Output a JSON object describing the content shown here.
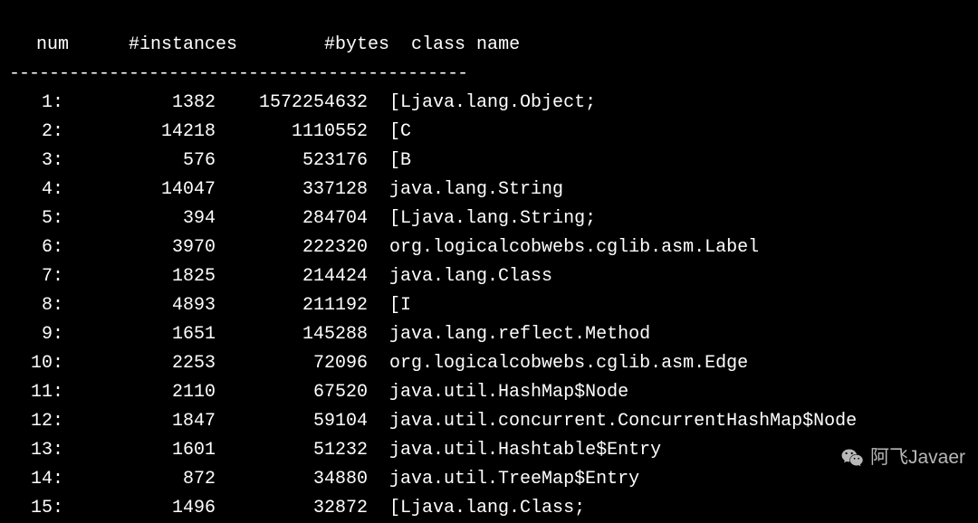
{
  "headers": {
    "num": "num",
    "instances": "#instances",
    "bytes": "#bytes",
    "className": "class name"
  },
  "separator": "----------------------------------------------",
  "rows": [
    {
      "num": "1:",
      "instances": "1382",
      "bytes": "1572254632",
      "className": "[Ljava.lang.Object;"
    },
    {
      "num": "2:",
      "instances": "14218",
      "bytes": "1110552",
      "className": "[C"
    },
    {
      "num": "3:",
      "instances": "576",
      "bytes": "523176",
      "className": "[B"
    },
    {
      "num": "4:",
      "instances": "14047",
      "bytes": "337128",
      "className": "java.lang.String"
    },
    {
      "num": "5:",
      "instances": "394",
      "bytes": "284704",
      "className": "[Ljava.lang.String;"
    },
    {
      "num": "6:",
      "instances": "3970",
      "bytes": "222320",
      "className": "org.logicalcobwebs.cglib.asm.Label"
    },
    {
      "num": "7:",
      "instances": "1825",
      "bytes": "214424",
      "className": "java.lang.Class"
    },
    {
      "num": "8:",
      "instances": "4893",
      "bytes": "211192",
      "className": "[I"
    },
    {
      "num": "9:",
      "instances": "1651",
      "bytes": "145288",
      "className": "java.lang.reflect.Method"
    },
    {
      "num": "10:",
      "instances": "2253",
      "bytes": "72096",
      "className": "org.logicalcobwebs.cglib.asm.Edge"
    },
    {
      "num": "11:",
      "instances": "2110",
      "bytes": "67520",
      "className": "java.util.HashMap$Node"
    },
    {
      "num": "12:",
      "instances": "1847",
      "bytes": "59104",
      "className": "java.util.concurrent.ConcurrentHashMap$Node"
    },
    {
      "num": "13:",
      "instances": "1601",
      "bytes": "51232",
      "className": "java.util.Hashtable$Entry"
    },
    {
      "num": "14:",
      "instances": "872",
      "bytes": "34880",
      "className": "java.util.TreeMap$Entry"
    },
    {
      "num": "15:",
      "instances": "1496",
      "bytes": "32872",
      "className": "[Ljava.lang.Class;"
    }
  ],
  "watermark": {
    "text": "阿飞Javaer"
  }
}
